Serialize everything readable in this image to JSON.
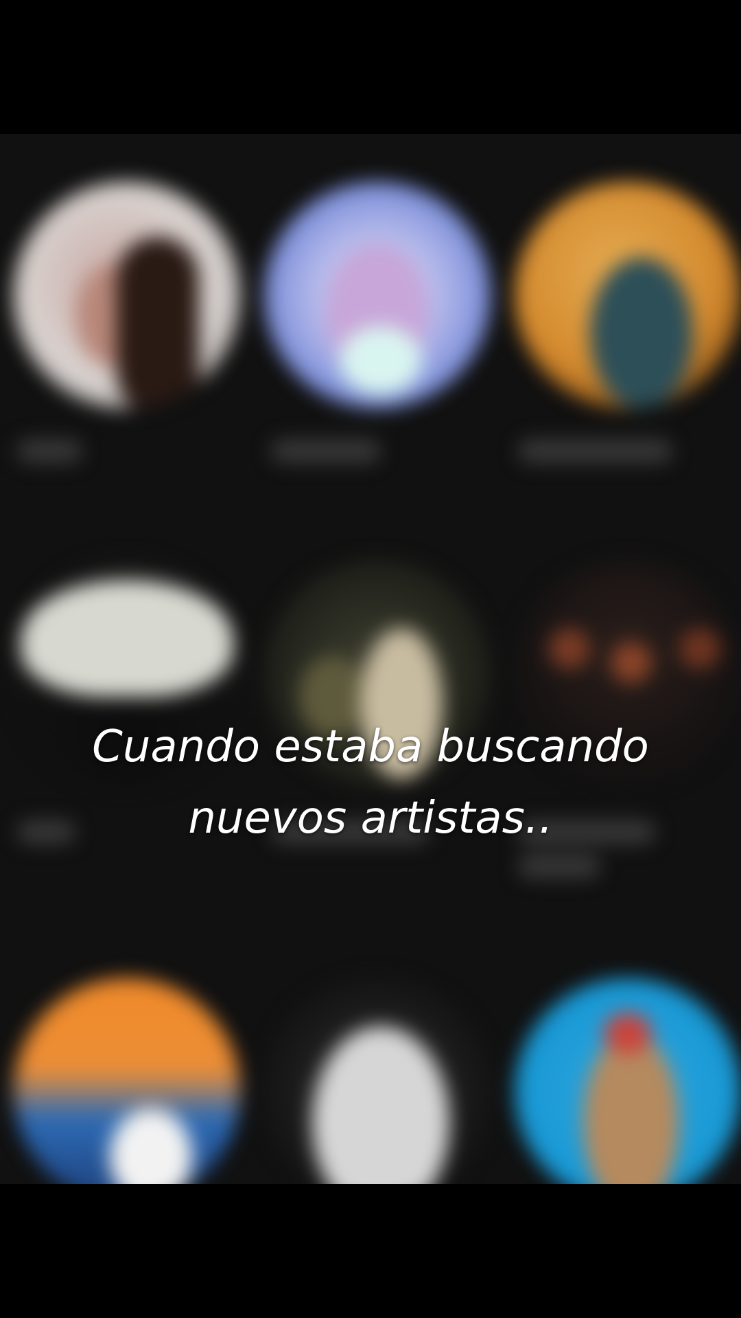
{
  "caption": {
    "line1": "Cuando estaba buscando",
    "line2": "nuevos artistas.."
  },
  "colors": {
    "letterbox": "#000000",
    "background": "#111111",
    "caption_text": "#ffffff"
  },
  "artists": [
    {
      "icon": "artist-avatar-icon",
      "row": 1,
      "col": 1
    },
    {
      "icon": "artist-avatar-icon",
      "row": 1,
      "col": 2
    },
    {
      "icon": "artist-avatar-icon",
      "row": 1,
      "col": 3
    },
    {
      "icon": "artist-avatar-icon",
      "row": 2,
      "col": 1
    },
    {
      "icon": "artist-avatar-icon",
      "row": 2,
      "col": 2
    },
    {
      "icon": "artist-avatar-icon",
      "row": 2,
      "col": 3
    },
    {
      "icon": "artist-avatar-icon",
      "row": 3,
      "col": 1
    },
    {
      "icon": "artist-avatar-icon",
      "row": 3,
      "col": 2
    },
    {
      "icon": "artist-avatar-icon",
      "row": 3,
      "col": 3
    }
  ]
}
